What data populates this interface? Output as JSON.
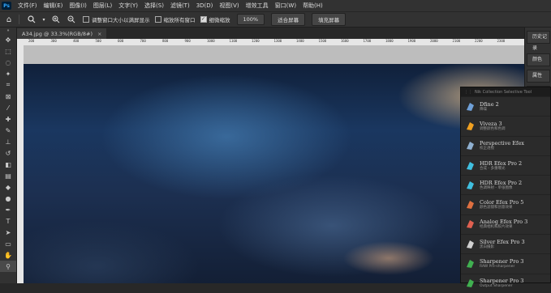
{
  "menubar": {
    "logo": "Ps",
    "items": [
      "文件(F)",
      "编辑(E)",
      "图像(I)",
      "图层(L)",
      "文字(Y)",
      "选择(S)",
      "滤镜(T)",
      "3D(D)",
      "视图(V)",
      "增效工具",
      "窗口(W)",
      "帮助(H)"
    ]
  },
  "options": {
    "resize_windows_label": "调整窗口大小以满屏显示",
    "zoom_all_label": "缩放所有窗口",
    "scrubby_zoom_label": "细微缩放",
    "zoom_value": "100%",
    "fit_screen_label": "适合屏幕",
    "fill_screen_label": "填充屏幕"
  },
  "document": {
    "tab_title": "A34.jpg @ 33.3%(RGB/8#)",
    "close": "×",
    "ruler_labels": [
      "200",
      "300",
      "400",
      "500",
      "600",
      "700",
      "800",
      "900",
      "1000",
      "1100",
      "1200",
      "1300",
      "1400",
      "1500",
      "1600",
      "1700",
      "1800",
      "1900",
      "2000",
      "2100",
      "2200",
      "2300"
    ]
  },
  "right_panel": {
    "history_label": "历史记录",
    "color_label": "颜色",
    "properties_label": "属性",
    "layers_label": "图层"
  },
  "nik": {
    "title": "Nik Collection Selective Tool",
    "items": [
      {
        "name": "Dfine 2",
        "sub": "降噪",
        "color": "#6fa0d8",
        "icon": "dfine-icon"
      },
      {
        "name": "Viveza 3",
        "sub": "调整颜色和色调",
        "color": "#f0a020",
        "icon": "viveza-icon"
      },
      {
        "name": "Perspective Efex",
        "sub": "校正透视",
        "color": "#8fb0d0",
        "icon": "perspective-icon"
      },
      {
        "name": "HDR Efex Pro 2",
        "sub": "合成 - 多重曝光",
        "color": "#40c0e0",
        "icon": "hdr-icon"
      },
      {
        "name": "HDR Efex Pro 2",
        "sub": "色调映射 - 单张图像",
        "color": "#40c0e0",
        "icon": "hdr-icon"
      },
      {
        "name": "Color Efex Pro 5",
        "sub": "颜色滤镜和创意效果",
        "color": "#e07040",
        "icon": "color-efex-icon"
      },
      {
        "name": "Analog Efex Pro 3",
        "sub": "经典相机和胶片效果",
        "color": "#e06050",
        "icon": "analog-efex-icon"
      },
      {
        "name": "Silver Efex Pro 3",
        "sub": "黑白摄影",
        "color": "#d0d0d0",
        "icon": "silver-efex-icon"
      },
      {
        "name": "Sharpener Pro 3",
        "sub": "RAW Pre-sharpener",
        "color": "#40b050",
        "icon": "sharpener-icon"
      },
      {
        "name": "Sharpener Pro 3",
        "sub": "Output Sharpener",
        "color": "#40b050",
        "icon": "sharpener-icon"
      }
    ]
  }
}
